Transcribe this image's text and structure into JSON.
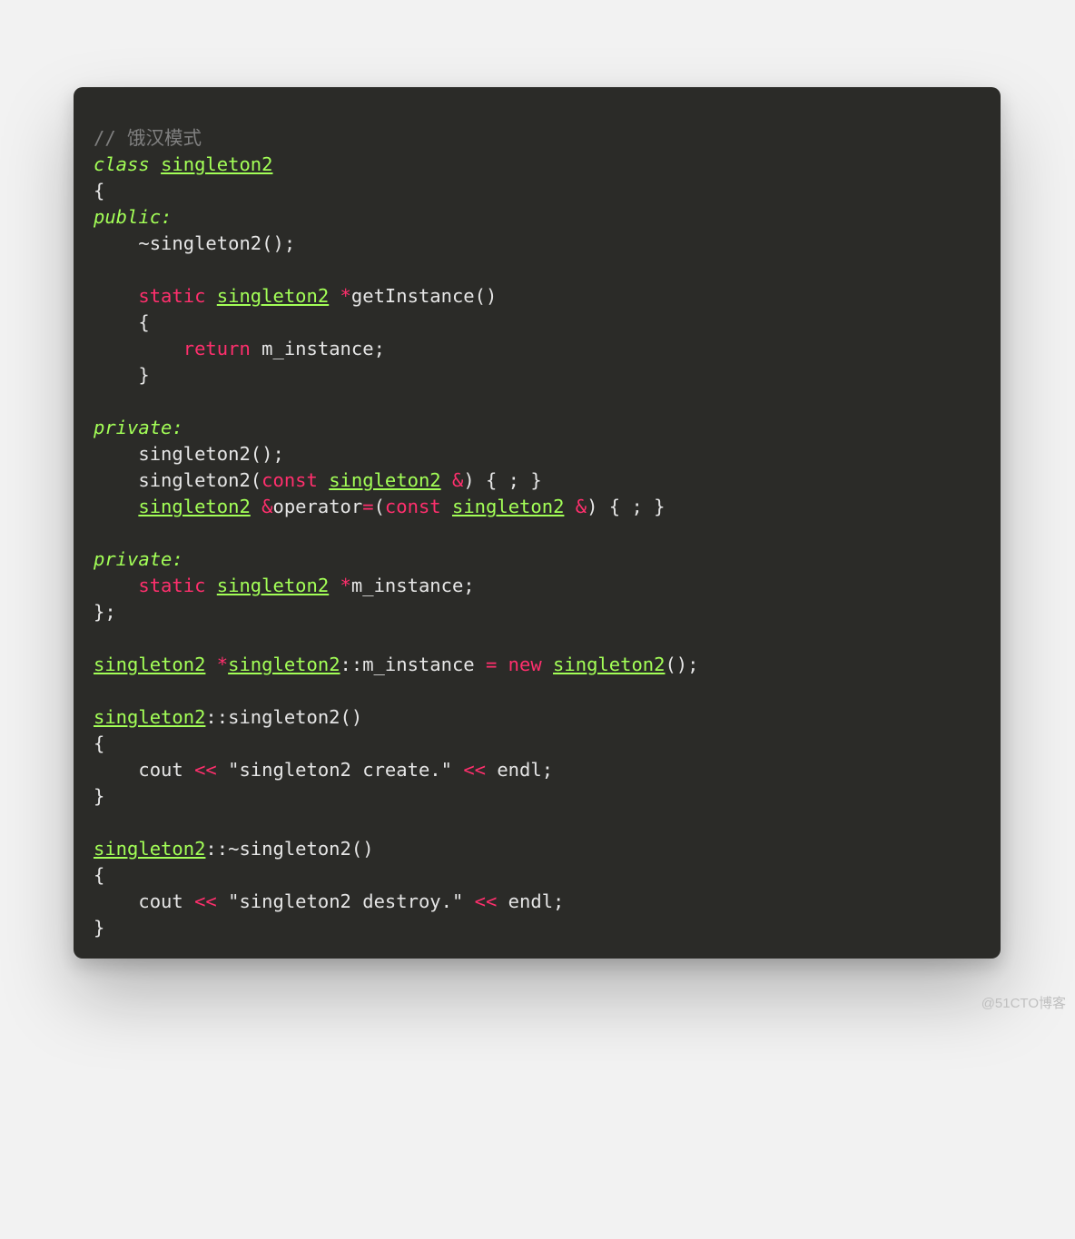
{
  "watermark": "@51CTO博客",
  "code": {
    "lines": [
      [
        {
          "cls": "cm",
          "t": "// 饿汉模式"
        }
      ],
      [
        {
          "cls": "kw",
          "t": "class"
        },
        {
          "cls": "fn",
          "t": " "
        },
        {
          "cls": "ty",
          "t": "singleton2"
        }
      ],
      [
        {
          "cls": "fn",
          "t": "{"
        }
      ],
      [
        {
          "cls": "kw",
          "t": "public:"
        }
      ],
      [
        {
          "cls": "fn",
          "t": "    ~singleton2();"
        }
      ],
      [
        {
          "cls": "fn",
          "t": ""
        }
      ],
      [
        {
          "cls": "fn",
          "t": "    "
        },
        {
          "cls": "kw2",
          "t": "static"
        },
        {
          "cls": "fn",
          "t": " "
        },
        {
          "cls": "ty",
          "t": "singleton2"
        },
        {
          "cls": "fn",
          "t": " "
        },
        {
          "cls": "ptr",
          "t": "*"
        },
        {
          "cls": "fn",
          "t": "getInstance()"
        }
      ],
      [
        {
          "cls": "fn",
          "t": "    {"
        }
      ],
      [
        {
          "cls": "fn",
          "t": "        "
        },
        {
          "cls": "kw2",
          "t": "return"
        },
        {
          "cls": "fn",
          "t": " m_instance;"
        }
      ],
      [
        {
          "cls": "fn",
          "t": "    }"
        }
      ],
      [
        {
          "cls": "fn",
          "t": ""
        }
      ],
      [
        {
          "cls": "kw",
          "t": "private:"
        }
      ],
      [
        {
          "cls": "fn",
          "t": "    singleton2();"
        }
      ],
      [
        {
          "cls": "fn",
          "t": "    singleton2("
        },
        {
          "cls": "kw2",
          "t": "const"
        },
        {
          "cls": "fn",
          "t": " "
        },
        {
          "cls": "ty",
          "t": "singleton2"
        },
        {
          "cls": "fn",
          "t": " "
        },
        {
          "cls": "kw2",
          "t": "&"
        },
        {
          "cls": "fn",
          "t": ") { ; }"
        }
      ],
      [
        {
          "cls": "fn",
          "t": "    "
        },
        {
          "cls": "ty",
          "t": "singleton2"
        },
        {
          "cls": "fn",
          "t": " "
        },
        {
          "cls": "kw2",
          "t": "&"
        },
        {
          "cls": "fn",
          "t": "operator"
        },
        {
          "cls": "kw2",
          "t": "="
        },
        {
          "cls": "fn",
          "t": "("
        },
        {
          "cls": "kw2",
          "t": "const"
        },
        {
          "cls": "fn",
          "t": " "
        },
        {
          "cls": "ty",
          "t": "singleton2"
        },
        {
          "cls": "fn",
          "t": " "
        },
        {
          "cls": "kw2",
          "t": "&"
        },
        {
          "cls": "fn",
          "t": ") { ; }"
        }
      ],
      [
        {
          "cls": "fn",
          "t": ""
        }
      ],
      [
        {
          "cls": "kw",
          "t": "private:"
        }
      ],
      [
        {
          "cls": "fn",
          "t": "    "
        },
        {
          "cls": "kw2",
          "t": "static"
        },
        {
          "cls": "fn",
          "t": " "
        },
        {
          "cls": "ty",
          "t": "singleton2"
        },
        {
          "cls": "fn",
          "t": " "
        },
        {
          "cls": "ptr",
          "t": "*"
        },
        {
          "cls": "fn",
          "t": "m_instance;"
        }
      ],
      [
        {
          "cls": "fn",
          "t": "};"
        }
      ],
      [
        {
          "cls": "fn",
          "t": ""
        }
      ],
      [
        {
          "cls": "ty",
          "t": "singleton2"
        },
        {
          "cls": "fn",
          "t": " "
        },
        {
          "cls": "ptr",
          "t": "*"
        },
        {
          "cls": "ty",
          "t": "singleton2"
        },
        {
          "cls": "fn",
          "t": "::m_instance "
        },
        {
          "cls": "kw2",
          "t": "="
        },
        {
          "cls": "fn",
          "t": " "
        },
        {
          "cls": "kw2",
          "t": "new"
        },
        {
          "cls": "fn",
          "t": " "
        },
        {
          "cls": "ty",
          "t": "singleton2"
        },
        {
          "cls": "fn",
          "t": "();"
        }
      ],
      [
        {
          "cls": "fn",
          "t": ""
        }
      ],
      [
        {
          "cls": "ty",
          "t": "singleton2"
        },
        {
          "cls": "fn",
          "t": "::singleton2()"
        }
      ],
      [
        {
          "cls": "fn",
          "t": "{"
        }
      ],
      [
        {
          "cls": "fn",
          "t": "    cout "
        },
        {
          "cls": "kw2",
          "t": "<<"
        },
        {
          "cls": "fn",
          "t": " \"singleton2 create.\" "
        },
        {
          "cls": "kw2",
          "t": "<<"
        },
        {
          "cls": "fn",
          "t": " endl;"
        }
      ],
      [
        {
          "cls": "fn",
          "t": "}"
        }
      ],
      [
        {
          "cls": "fn",
          "t": ""
        }
      ],
      [
        {
          "cls": "ty",
          "t": "singleton2"
        },
        {
          "cls": "fn",
          "t": "::~singleton2()"
        }
      ],
      [
        {
          "cls": "fn",
          "t": "{"
        }
      ],
      [
        {
          "cls": "fn",
          "t": "    cout "
        },
        {
          "cls": "kw2",
          "t": "<<"
        },
        {
          "cls": "fn",
          "t": " \"singleton2 destroy.\" "
        },
        {
          "cls": "kw2",
          "t": "<<"
        },
        {
          "cls": "fn",
          "t": " endl;"
        }
      ],
      [
        {
          "cls": "fn",
          "t": "}"
        }
      ]
    ]
  }
}
